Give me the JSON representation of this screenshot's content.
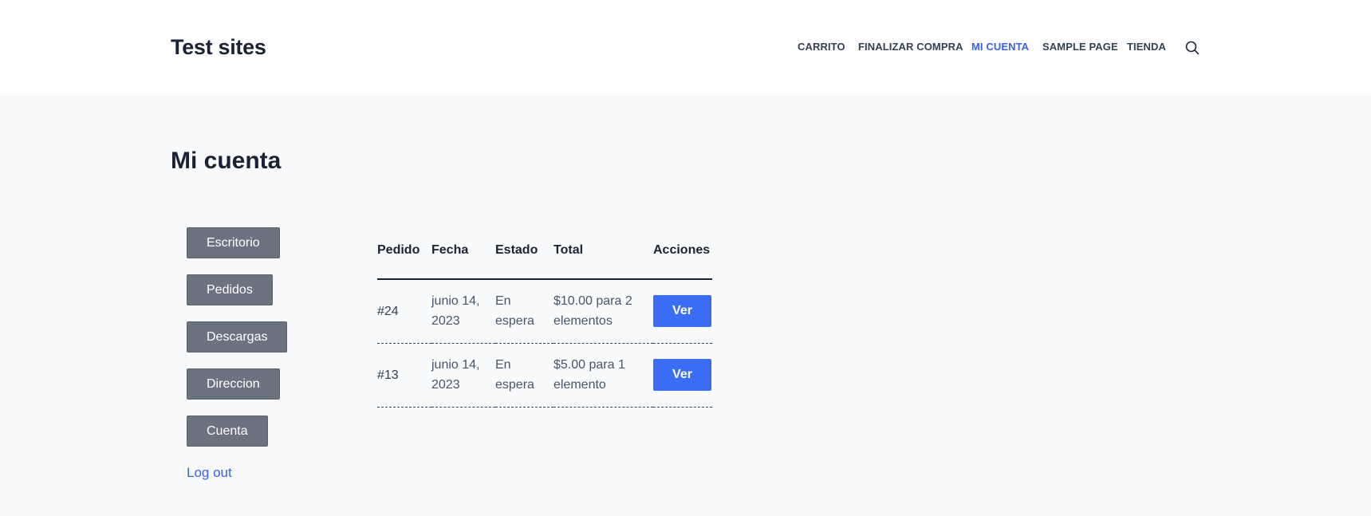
{
  "header": {
    "site_title": "Test sites",
    "nav": [
      {
        "label": "CARRITO",
        "active": false
      },
      {
        "label": "FINALIZAR COMPRA",
        "active": false
      },
      {
        "label": "MI CUENTA",
        "active": true
      },
      {
        "label": "SAMPLE PAGE",
        "active": false
      },
      {
        "label": "TIENDA",
        "active": false
      }
    ],
    "search_icon": "search-icon"
  },
  "page": {
    "title": "Mi cuenta"
  },
  "account_nav": {
    "items": [
      "Escritorio",
      "Pedidos",
      "Descargas",
      "Direccion",
      "Cuenta"
    ],
    "logout": "Log out"
  },
  "orders": {
    "columns": [
      "Pedido",
      "Fecha",
      "Estado",
      "Total",
      "Acciones"
    ],
    "rows": [
      {
        "order": "#24",
        "date_l1": "junio 14,",
        "date_l2": "2023",
        "status_l1": "En",
        "status_l2": "espera",
        "total_l1": "$10.00 para 2",
        "total_l2": "elementos",
        "action": "Ver"
      },
      {
        "order": "#13",
        "date_l1": "junio 14,",
        "date_l2": "2023",
        "status_l1": "En",
        "status_l2": "espera",
        "total_l1": "$5.00 para 1",
        "total_l2": "elemento",
        "action": "Ver"
      }
    ]
  },
  "colors": {
    "accent": "#3a62e8",
    "button_primary": "#3b6cf6",
    "button_secondary": "#6b7280",
    "text_dark": "#1a2236",
    "page_bg": "#f8fafc",
    "header_bg": "#ffffff"
  }
}
